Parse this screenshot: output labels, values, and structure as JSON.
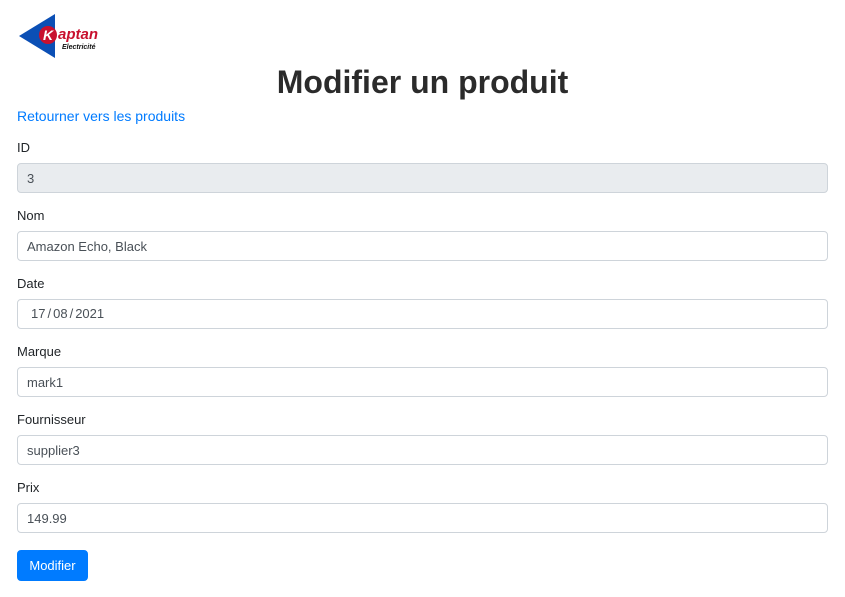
{
  "brand": {
    "logo_letter": "K",
    "logo_name": "aptan",
    "logo_tagline": "Electricité",
    "primary_color": "#0b4fb5",
    "accent_color": "#c8102e"
  },
  "page": {
    "title": "Modifier un produit",
    "back_link": "Retourner vers les produits"
  },
  "form": {
    "id": {
      "label": "ID",
      "value": "3",
      "readonly": true
    },
    "nom": {
      "label": "Nom",
      "value": "Amazon Echo, Black"
    },
    "date": {
      "label": "Date",
      "day": "17",
      "month": "08",
      "year": "2021",
      "separator": "/"
    },
    "marque": {
      "label": "Marque",
      "value": "mark1"
    },
    "fournisseur": {
      "label": "Fournisseur",
      "value": "supplier3"
    },
    "prix": {
      "label": "Prix",
      "value": "149.99"
    },
    "submit_label": "Modifier"
  },
  "colors": {
    "link": "#007bff",
    "button": "#007bff",
    "readonly_bg": "#e9ecef",
    "border": "#ced4da"
  }
}
